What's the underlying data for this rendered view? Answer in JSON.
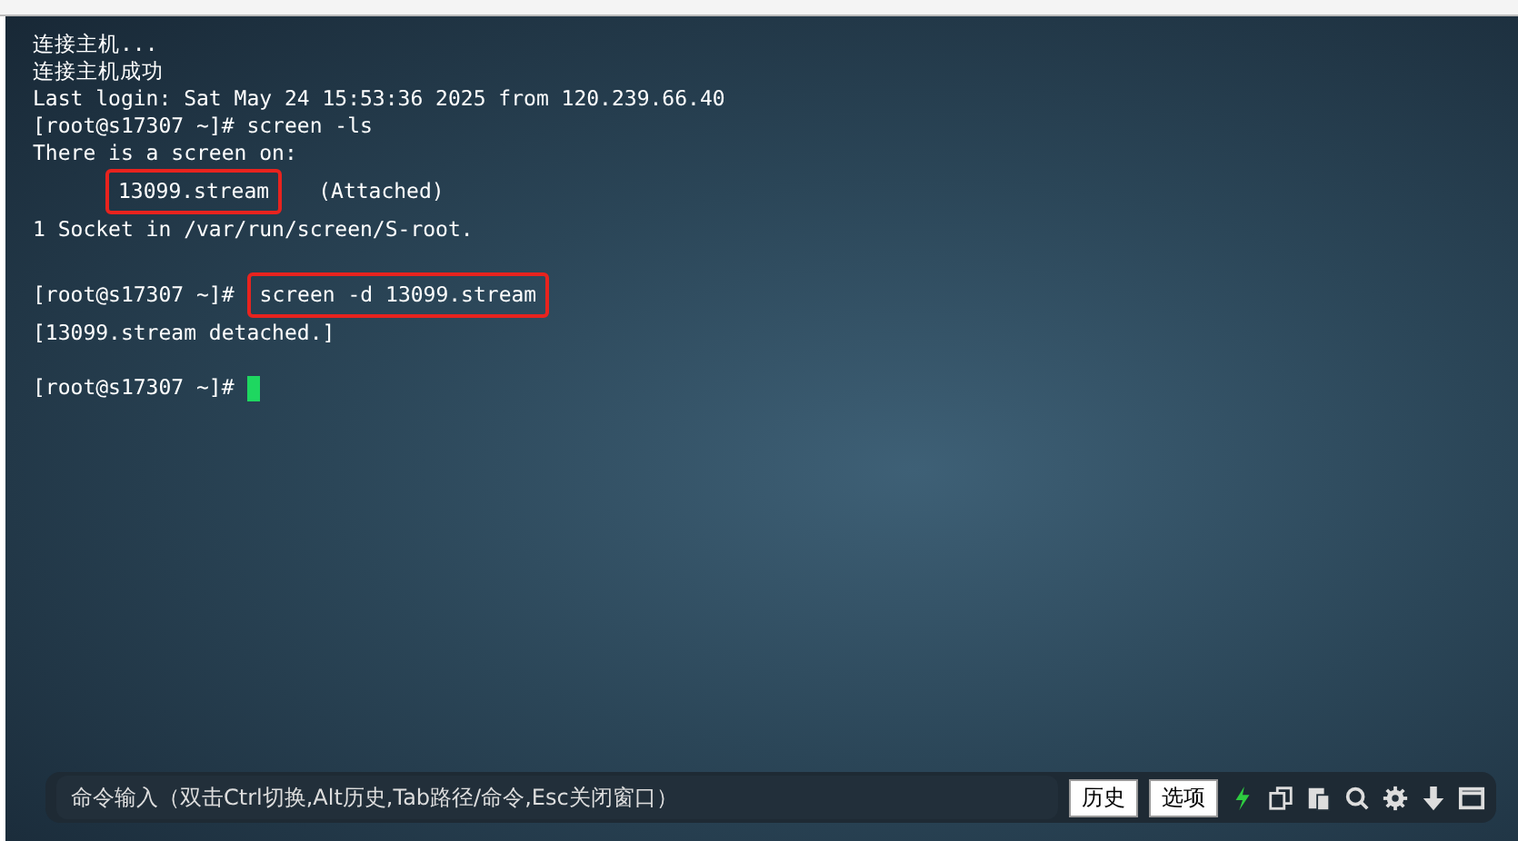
{
  "terminal": {
    "lines": [
      {
        "segments": [
          {
            "text": "连接主机...",
            "highlighted": false
          }
        ],
        "indented": false,
        "cursor": false
      },
      {
        "segments": [
          {
            "text": "连接主机成功",
            "highlighted": false
          }
        ],
        "indented": false,
        "cursor": false
      },
      {
        "segments": [
          {
            "text": "Last login: Sat May 24 15:53:36 2025 from 120.239.66.40",
            "highlighted": false
          }
        ],
        "indented": false,
        "cursor": false
      },
      {
        "segments": [
          {
            "text": "[root@s17307 ~]# screen -ls",
            "highlighted": false
          }
        ],
        "indented": false,
        "cursor": false
      },
      {
        "segments": [
          {
            "text": "There is a screen on:",
            "highlighted": false
          }
        ],
        "indented": false,
        "cursor": false
      },
      {
        "segments": [
          {
            "text": "13099.stream",
            "highlighted": true
          },
          {
            "text": "(Attached)",
            "highlighted": false
          }
        ],
        "indented": true,
        "cursor": false
      },
      {
        "segments": [
          {
            "text": "1 Socket in /var/run/screen/S-root.",
            "highlighted": false
          }
        ],
        "indented": false,
        "cursor": false
      },
      {
        "cursor": false
      },
      {
        "segments": [
          {
            "text": "[root@s17307 ~]#",
            "highlighted": false
          },
          {
            "text": "screen -d 13099.stream",
            "highlighted": true
          }
        ],
        "indented": false,
        "cursor": false
      },
      {
        "segments": [
          {
            "text": "[13099.stream detached.]",
            "highlighted": false
          }
        ],
        "indented": false,
        "cursor": false
      },
      {
        "cursor": false
      },
      {
        "segments": [
          {
            "text": "[root@s17307 ~]#",
            "highlighted": false
          }
        ],
        "indented": false,
        "cursor": true
      }
    ]
  },
  "command_bar": {
    "placeholder": "命令输入（双击Ctrl切换,Alt历史,Tab路径/命令,Esc关闭窗口）",
    "buttons": [
      "历史",
      "选项"
    ]
  }
}
